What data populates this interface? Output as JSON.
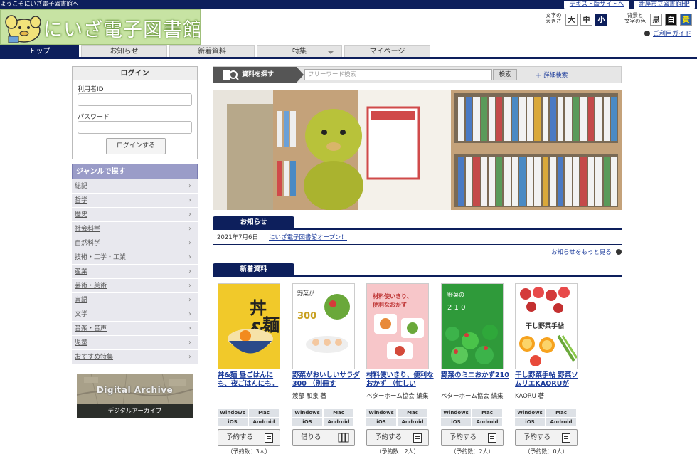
{
  "topbar": {
    "welcome": "ようこそにいざ電子図書館へ",
    "text_site": "テキスト版サイトへ",
    "library_hp": "新座市立図書館HP"
  },
  "logo": {
    "title": "にいざ電子図書館"
  },
  "display": {
    "size_label_1": "文字の",
    "size_label_2": "大きさ",
    "size_large": "大",
    "size_medium": "中",
    "size_small": "小",
    "color_label_1": "背景と",
    "color_label_2": "文字の色",
    "color_black": "黒",
    "color_white": "白",
    "color_yellow": "黄"
  },
  "guide": "ご利用ガイド",
  "nav": {
    "tabs": [
      {
        "label": "トップ"
      },
      {
        "label": "お知らせ"
      },
      {
        "label": "新着資料"
      },
      {
        "label": "特集"
      },
      {
        "label": "マイページ"
      }
    ]
  },
  "login": {
    "title": "ログイン",
    "user_id_label": "利用者ID",
    "password_label": "パスワード",
    "button": "ログインする"
  },
  "genre": {
    "title": "ジャンルで探す",
    "items": [
      {
        "label": "総記"
      },
      {
        "label": "哲学"
      },
      {
        "label": "歴史"
      },
      {
        "label": "社会科学"
      },
      {
        "label": "自然科学"
      },
      {
        "label": "技術・工学・工業"
      },
      {
        "label": "産業"
      },
      {
        "label": "芸術・美術"
      },
      {
        "label": "言語"
      },
      {
        "label": "文学"
      },
      {
        "label": "音楽・音声"
      },
      {
        "label": "児童"
      },
      {
        "label": "おすすめ特集"
      }
    ]
  },
  "archive": {
    "title": "Digital Archive",
    "label": "デジタルアーカイブ"
  },
  "search": {
    "label": "資料を探す",
    "placeholder": "フリーワード検索",
    "button": "検索",
    "advanced": "詳細検索"
  },
  "news": {
    "title": "お知らせ",
    "items": [
      {
        "date": "2021年7月6日",
        "title": "にいざ電子図書館オープン！"
      }
    ],
    "more": "お知らせをもっと見る"
  },
  "new_items": {
    "title": "新着資料",
    "platform_labels": [
      "Windows",
      "Mac",
      "iOS",
      "Android"
    ],
    "books": [
      {
        "title": "丼&麺 昼ごはんにも、夜ごはんにも。",
        "author": "",
        "action": "予約する",
        "reservations": "（予約数：3人）",
        "cover_text_1": "丼&",
        "cover_text_2": "麺"
      },
      {
        "title": "野菜がおいしいサラダ300 （別冊す",
        "author": "渡部 和泉 著",
        "action": "借りる",
        "reservations": "",
        "cover_text_1": "野菜が",
        "cover_text_2": "300"
      },
      {
        "title": "材料使いきり、便利なおかず （忙しい",
        "author": "ベターホーム協会 編集",
        "action": "予約する",
        "reservations": "（予約数：2人）",
        "cover_text_1": "材料使いきり、",
        "cover_text_2": "便利なおかず"
      },
      {
        "title": "野菜のミニおかず210",
        "author": "ベターホーム協会 編集",
        "action": "予約する",
        "reservations": "（予約数：2人）",
        "cover_text_1": "野菜の",
        "cover_text_2": "2 1 0"
      },
      {
        "title": "干し野菜手帖 野菜ソムリエKAORUが",
        "author": "KAORU 著",
        "action": "予約する",
        "reservations": "（予約数：0人）",
        "cover_text_1": "干し野菜手帖",
        "cover_text_2": ""
      }
    ]
  }
}
